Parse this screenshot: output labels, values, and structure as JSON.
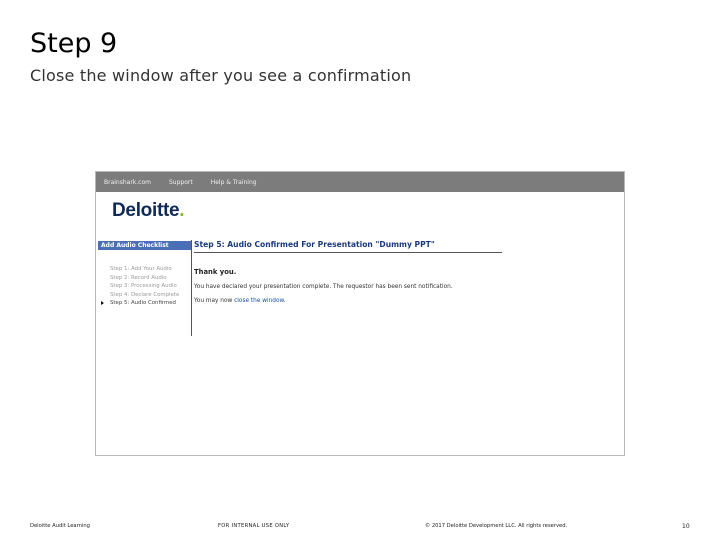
{
  "slide": {
    "title": "Step 9",
    "subtitle": "Close the window after you see a confirmation"
  },
  "screenshot": {
    "nav": [
      "Brainshark.com",
      "Support",
      "Help & Training"
    ],
    "logo": {
      "text": "Deloitte",
      "dot": "."
    },
    "checklist": {
      "header": "Add Audio Checklist",
      "items": [
        "Step 1: Add Your Audio",
        "Step 2: Record Audio",
        "Step 3: Processing Audio",
        "Step 4: Declare Complete",
        "Step 5: Audio Confirmed"
      ]
    },
    "content": {
      "step_title": "Step 5: Audio Confirmed For Presentation \"Dummy PPT\"",
      "thanks": "Thank you.",
      "para1": "You have declared your presentation complete. The requestor has been sent notification.",
      "para2_prefix": "You may now ",
      "para2_link": "close the window",
      "para2_suffix": "."
    }
  },
  "footer": {
    "left": "Deloitte Audit Learning",
    "center": "FOR INTERNAL USE ONLY",
    "right": "© 2017 Deloitte Development LLC. All rights reserved.",
    "page": "10"
  },
  "colors": {
    "nav_bar": "#7c7c7c",
    "checklist_header": "#4a6fb7",
    "logo_text": "#0f2a55",
    "logo_dot": "#86bc25",
    "link": "#1a4ea8"
  }
}
